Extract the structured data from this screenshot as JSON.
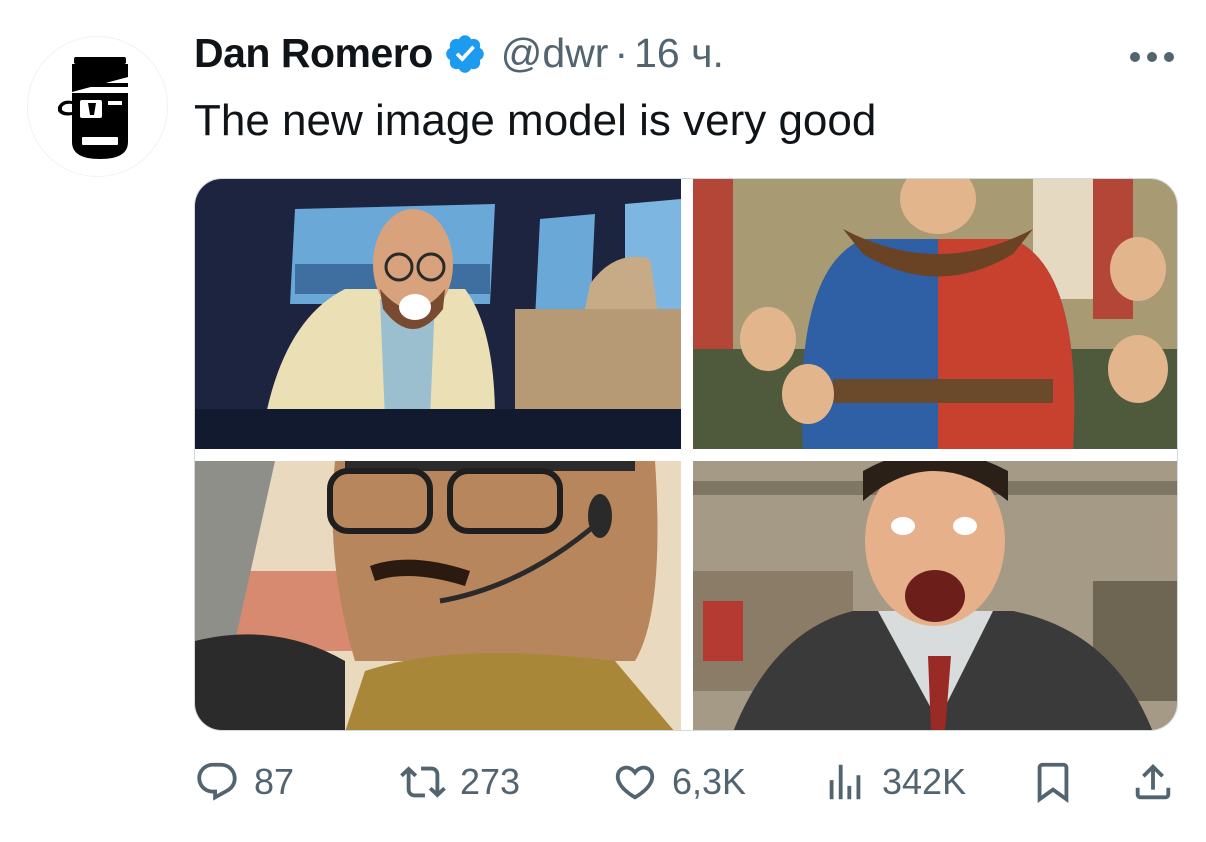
{
  "author": {
    "name": "Dan Romero",
    "handle": "@dwr",
    "separator": "·",
    "time": "16 ч.",
    "verified": true,
    "avatar_icon": "pirate-head-avatar-icon"
  },
  "tweet": {
    "text": "The new image model is very good"
  },
  "media": [
    {
      "alt_icon": "cartoon-bald-man-shouting-in-car-image"
    },
    {
      "alt_icon": "cartoon-knight-crowd-cheering-image"
    },
    {
      "alt_icon": "cartoon-man-with-headset-driving-image"
    },
    {
      "alt_icon": "cartoon-man-in-suit-shouting-image"
    }
  ],
  "actions": {
    "replies": "87",
    "reposts": "273",
    "likes": "6,3K",
    "views": "342K"
  },
  "colors": {
    "text_primary": "#0f1419",
    "text_secondary": "#536471",
    "verified_blue": "#1d9bf0",
    "border": "#cfd9de"
  }
}
